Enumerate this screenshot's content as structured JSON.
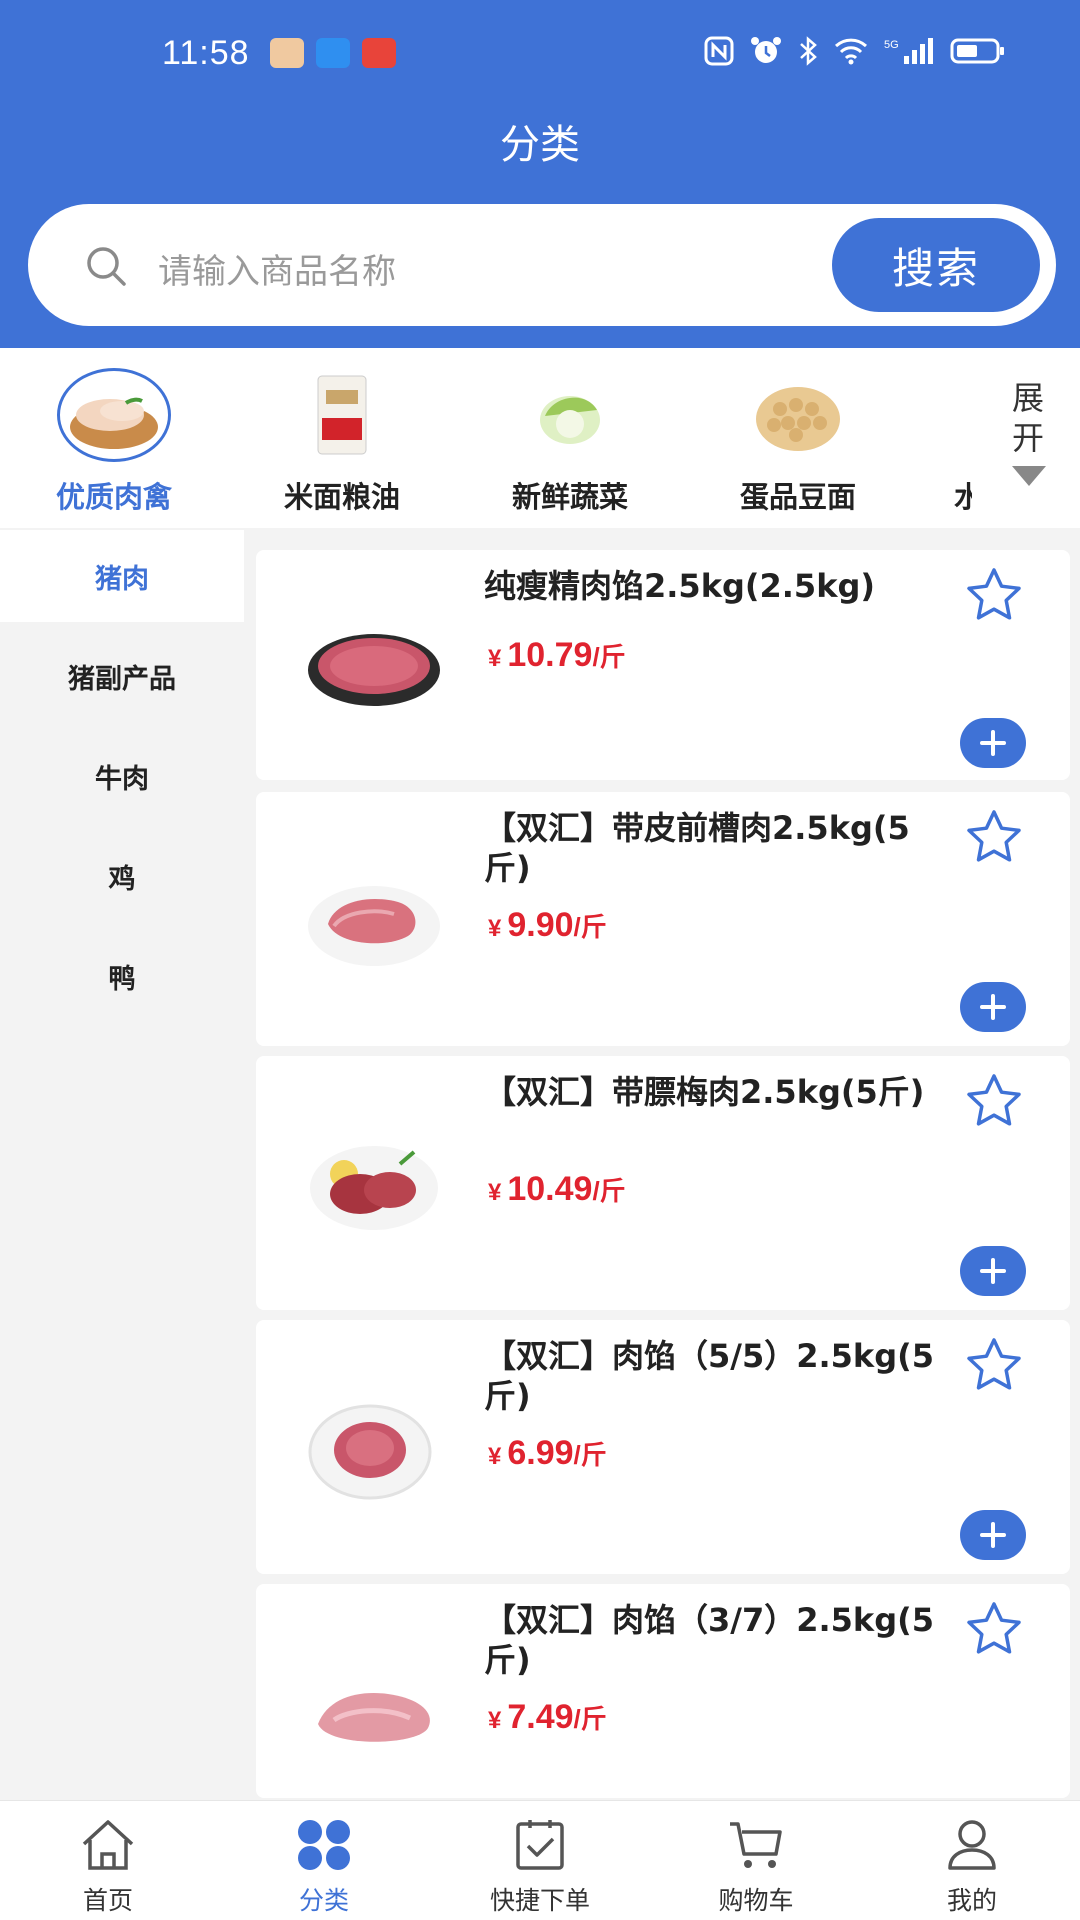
{
  "status_bar": {
    "time": "11:58",
    "network": "5G"
  },
  "header": {
    "title": "分类"
  },
  "search": {
    "placeholder": "请输入商品名称",
    "button_label": "搜索"
  },
  "categories": {
    "items": [
      {
        "label": "优质肉禽",
        "icon": "poultry-image",
        "selected": true
      },
      {
        "label": "米面粮油",
        "icon": "rice-bag-image",
        "selected": false
      },
      {
        "label": "新鲜蔬菜",
        "icon": "cabbage-image",
        "selected": false
      },
      {
        "label": "蛋品豆面",
        "icon": "soybean-image",
        "selected": false
      },
      {
        "label": "水",
        "icon": "",
        "selected": false
      }
    ],
    "expand_label": "展开"
  },
  "subcategories": [
    {
      "label": "猪肉",
      "active": true
    },
    {
      "label": "猪副产品",
      "active": false
    },
    {
      "label": "牛肉",
      "active": false
    },
    {
      "label": "鸡",
      "active": false
    },
    {
      "label": "鸭",
      "active": false
    }
  ],
  "products": [
    {
      "name": "纯瘦精肉馅2.5kg(2.5kg)",
      "currency": "¥",
      "price": "10.79",
      "unit": "/斤",
      "image": "minced-lean-pork-image"
    },
    {
      "name": "【双汇】带皮前槽肉2.5kg(5斤)",
      "currency": "¥",
      "price": "9.90",
      "unit": "/斤",
      "image": "pork-shoulder-image"
    },
    {
      "name": "【双汇】带膘梅肉2.5kg(5斤)",
      "currency": "¥",
      "price": "10.49",
      "unit": "/斤",
      "image": "pork-collar-image"
    },
    {
      "name": "【双汇】肉馅（5/5）2.5kg(5斤)",
      "currency": "¥",
      "price": "6.99",
      "unit": "/斤",
      "image": "minced-pork-plate-image"
    },
    {
      "name": "【双汇】肉馅（3/7）2.5kg(5斤)",
      "currency": "¥",
      "price": "7.49",
      "unit": "/斤",
      "image": "minced-pork-image"
    }
  ],
  "bottom_nav": [
    {
      "label": "首页",
      "icon": "home-icon",
      "active": false
    },
    {
      "label": "分类",
      "icon": "category-icon",
      "active": true
    },
    {
      "label": "快捷下单",
      "icon": "quick-order-icon",
      "active": false
    },
    {
      "label": "购物车",
      "icon": "cart-icon",
      "active": false
    },
    {
      "label": "我的",
      "icon": "profile-icon",
      "active": false
    }
  ],
  "colors": {
    "primary": "#3f72d6",
    "price": "#e0232f",
    "background": "#f3f3f3"
  }
}
